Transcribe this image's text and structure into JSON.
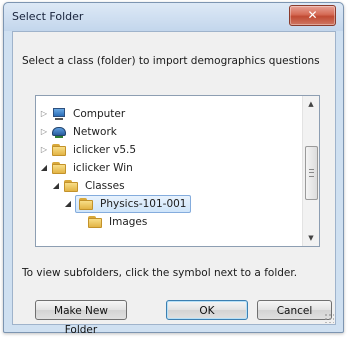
{
  "window": {
    "title": "Select Folder",
    "close_glyph": "✕"
  },
  "instruction": "Select a class (folder) to import demographics questions",
  "tree": {
    "items": [
      {
        "label": "Computer",
        "icon": "computer-icon",
        "expanded": false,
        "selected": false
      },
      {
        "label": "Network",
        "icon": "network-icon",
        "expanded": false,
        "selected": false
      },
      {
        "label": "iclicker v5.5",
        "icon": "folder-icon",
        "expanded": false,
        "selected": false
      },
      {
        "label": "iclicker Win",
        "icon": "folder-icon",
        "expanded": true,
        "selected": false
      },
      {
        "label": "Classes",
        "icon": "folder-icon",
        "expanded": true,
        "selected": false
      },
      {
        "label": "Physics-101-001",
        "icon": "folder-icon",
        "expanded": true,
        "selected": true
      },
      {
        "label": "Images",
        "icon": "folder-icon",
        "expanded": false,
        "selected": false
      }
    ]
  },
  "hint": "To view subfolders, click the symbol next to a folder.",
  "buttons": {
    "make_new_folder": "Make New Folder",
    "ok": "OK",
    "cancel": "Cancel"
  }
}
